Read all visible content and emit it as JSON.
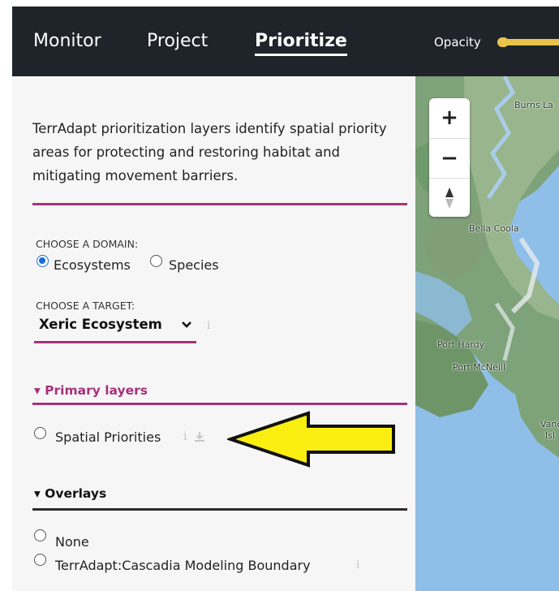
{
  "nav": {
    "tabs": [
      {
        "label": "Monitor"
      },
      {
        "label": "Project"
      },
      {
        "label": "Prioritize"
      }
    ],
    "opacity_label": "Opacity"
  },
  "sidebar": {
    "description": "TerrAdapt prioritization layers identify spatial priority areas for protecting and restoring habitat and mitigating movement barriers.",
    "domain": {
      "label": "CHOOSE A DOMAIN:",
      "options": [
        {
          "label": "Ecosystems",
          "checked": true
        },
        {
          "label": "Species",
          "checked": false
        }
      ]
    },
    "target": {
      "label": "CHOOSE A TARGET:",
      "selected": "Xeric Ecosystem"
    },
    "primary_layers": {
      "heading": "▾ Primary layers",
      "items": [
        {
          "label": "Spatial Priorities",
          "checked": false
        }
      ]
    },
    "overlays": {
      "heading": "▾ Overlays",
      "items": [
        {
          "label": "None",
          "checked": false
        },
        {
          "label": "TerrAdapt:Cascadia Modeling Boundary",
          "checked": false
        }
      ]
    }
  },
  "map": {
    "zoom_in": "+",
    "zoom_out": "−",
    "labels": [
      "Burns La",
      "Bella Coola",
      "Port Hardy",
      "Port McNeill",
      "Vanc",
      "Isl"
    ]
  },
  "colors": {
    "accent": "#a4327a",
    "nav_bg": "#1f242b",
    "arrow": "#f9ee10"
  }
}
